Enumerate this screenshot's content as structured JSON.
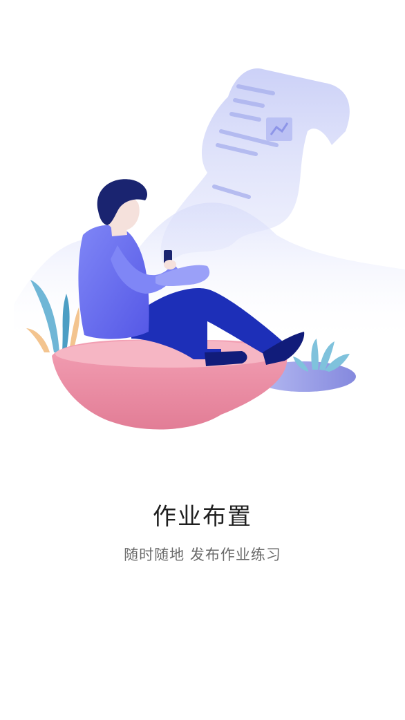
{
  "onboarding": {
    "title": "作业布置",
    "subtitle": "随时随地 发布作业练习"
  },
  "illustration": {
    "icon": "student-on-phone-illustration",
    "colors": {
      "rock": "#e98aa0",
      "figure_shirt": "#6c6ef0",
      "figure_pants": "#1d2fb8",
      "hair": "#1a2470",
      "paper": "#c9cff7",
      "mist": "#e6e8fb",
      "plant_teal": "#6fb6d6",
      "plant_orange": "#f3c48f"
    }
  }
}
